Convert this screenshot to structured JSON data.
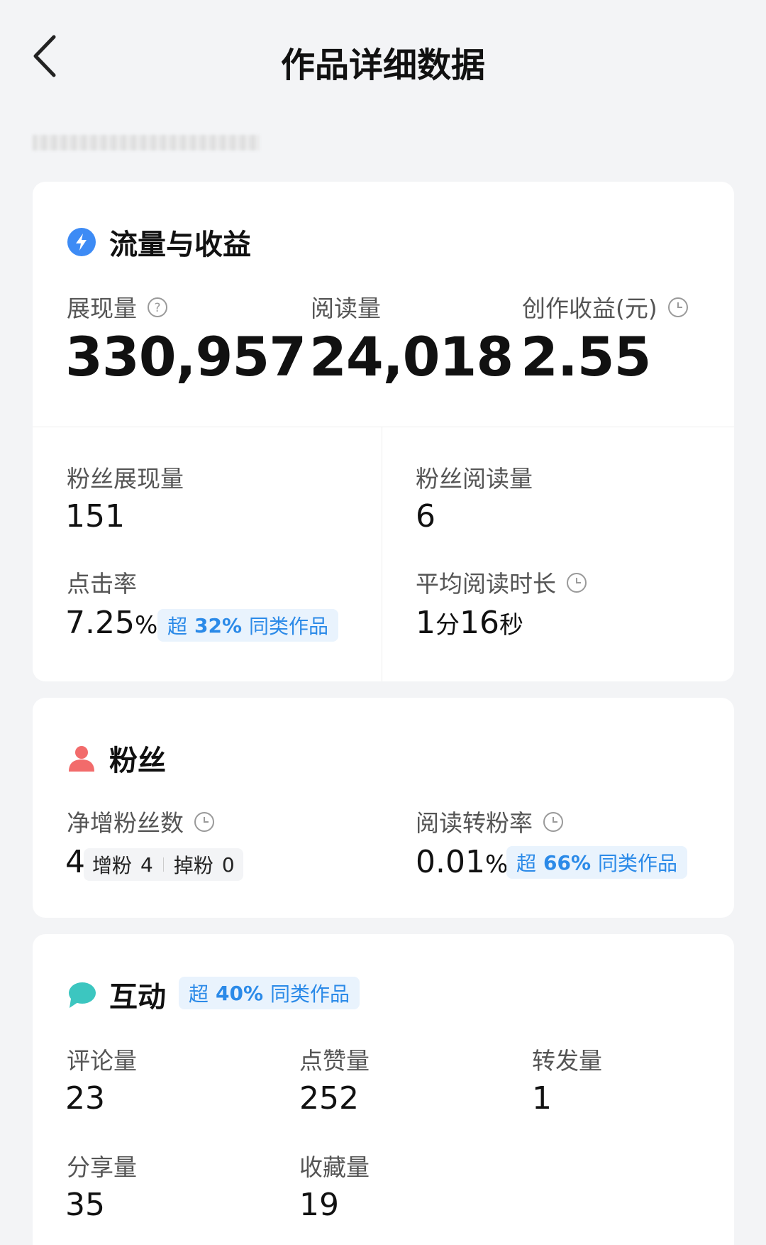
{
  "header": {
    "title": "作品详细数据"
  },
  "traffic": {
    "title": "流量与收益",
    "impressions": {
      "label": "展现量",
      "value": "330,957"
    },
    "reads": {
      "label": "阅读量",
      "value": "24,018"
    },
    "earnings": {
      "label": "创作收益(元)",
      "value": "2.55"
    },
    "fan_impressions": {
      "label": "粉丝展现量",
      "value": "151"
    },
    "fan_reads": {
      "label": "粉丝阅读量",
      "value": "6"
    },
    "ctr": {
      "label": "点击率",
      "value": "7.25",
      "unit": "%",
      "badge_prefix": "超",
      "badge_pct": "32%",
      "badge_suffix": "同类作品"
    },
    "avg_read_time": {
      "label": "平均阅读时长",
      "minutes": "1",
      "minutes_unit": "分",
      "seconds": "16",
      "seconds_unit": "秒"
    }
  },
  "fans": {
    "title": "粉丝",
    "net_gain": {
      "label": "净增粉丝数",
      "value": "4",
      "gain_label": "增粉",
      "gain_value": "4",
      "loss_label": "掉粉",
      "loss_value": "0"
    },
    "conversion": {
      "label": "阅读转粉率",
      "value": "0.01",
      "unit": "%",
      "badge_prefix": "超",
      "badge_pct": "66%",
      "badge_suffix": "同类作品"
    }
  },
  "interaction": {
    "title": "互动",
    "badge_prefix": "超",
    "badge_pct": "40%",
    "badge_suffix": "同类作品",
    "comments": {
      "label": "评论量",
      "value": "23"
    },
    "likes": {
      "label": "点赞量",
      "value": "252"
    },
    "reposts": {
      "label": "转发量",
      "value": "1"
    },
    "shares": {
      "label": "分享量",
      "value": "35"
    },
    "favorites": {
      "label": "收藏量",
      "value": "19"
    }
  },
  "colors": {
    "accent": "#2b8ae8",
    "badge_bg": "#e9f3fd",
    "traffic_icon": "#3d8bf5",
    "fans_icon": "#f26b6b",
    "interaction_icon": "#3cc6c0"
  },
  "icons": {
    "back": "chevron-left-icon",
    "traffic": "lightning-icon",
    "fans": "person-icon",
    "interaction": "chat-bubble-icon",
    "help": "question-icon",
    "time": "clock-icon"
  }
}
